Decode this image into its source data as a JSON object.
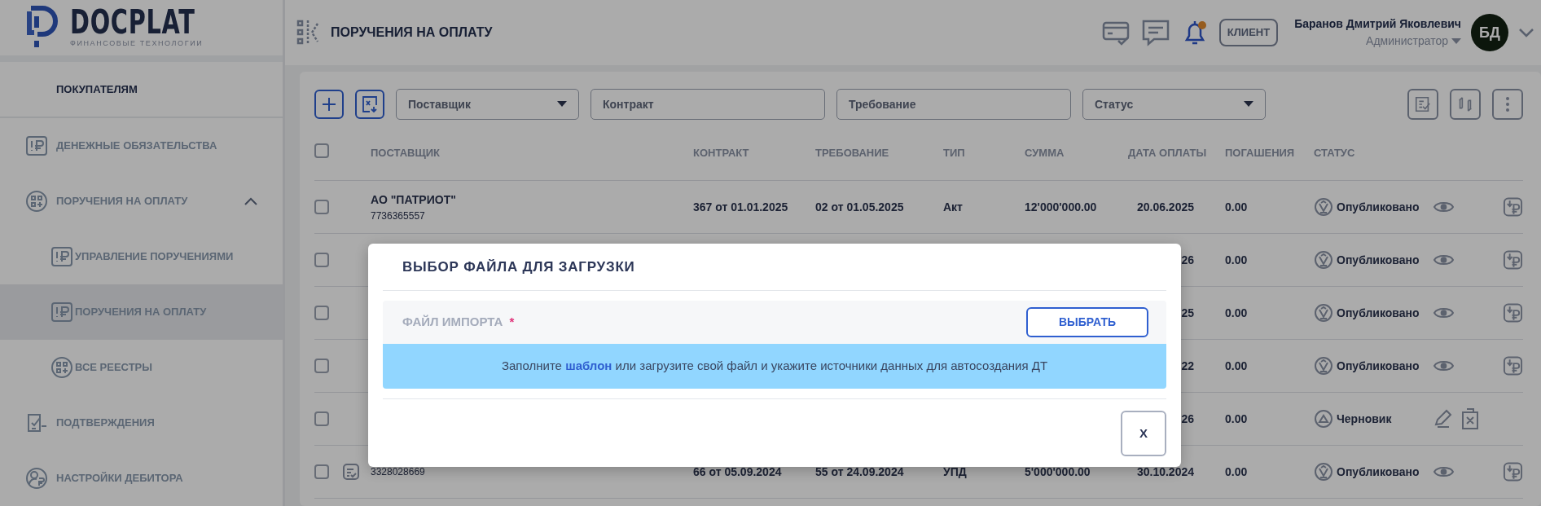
{
  "logo": {
    "name": "DOCPLAT",
    "tagline": "ФИНАНСОВЫЕ ТЕХНОЛОГИИ"
  },
  "sidebar": {
    "section": "ПОКУПАТЕЛЯМ",
    "items": [
      {
        "label": "ДЕНЕЖНЫЕ ОБЯЗАТЕЛЬСТВА",
        "selected": false
      },
      {
        "label": "ПОРУЧЕНИЯ НА ОПЛАТУ",
        "selected": false,
        "expanded": true,
        "children": [
          {
            "label": "УПРАВЛЕНИЕ ПОРУЧЕНИЯМИ",
            "selected": false
          },
          {
            "label": "ПОРУЧЕНИЯ НА ОПЛАТУ",
            "selected": true
          },
          {
            "label": "ВСЕ РЕЕСТРЫ",
            "selected": false
          }
        ]
      },
      {
        "label": "ПОДТВЕРЖДЕНИЯ",
        "selected": false
      },
      {
        "label": "НАСТРОЙКИ ДЕБИТОРА",
        "selected": false
      }
    ]
  },
  "header": {
    "title": "ПОРУЧЕНИЯ НА ОПЛАТУ",
    "notification": true,
    "role_badge": "КЛИЕНТ",
    "user_name": "Баранов Дмитрий Яковлевич",
    "user_role": "Администратор",
    "avatar_initials": "БД"
  },
  "filters": [
    {
      "kind": "select",
      "placeholder": "Поставщик"
    },
    {
      "kind": "input",
      "placeholder": "Контракт"
    },
    {
      "kind": "input",
      "placeholder": "Требование"
    },
    {
      "kind": "select",
      "placeholder": "Статус"
    }
  ],
  "table": {
    "header_checked": false,
    "columns": [
      "ПОСТАВЩИК",
      "КОНТРАКТ",
      "ТРЕБОВАНИЕ",
      "ТИП",
      "СУММА",
      "ДАТА ОПЛАТЫ",
      "ПОГАШЕНИЯ",
      "СТАТУС"
    ],
    "rows": [
      {
        "checked": false,
        "marked": false,
        "supplier": "АО \"ПАТРИОТ\"",
        "inn": "7736365557",
        "contract": "367 от 01.01.2025",
        "requirement": "02 от 01.05.2025",
        "type": "Акт",
        "sum": "12'000'000.00",
        "date": "20.06.2025",
        "repaid": "0.00",
        "status": "Опубликовано",
        "kind": "published"
      },
      {
        "checked": false,
        "marked": false,
        "date": "26",
        "repaid": "0.00",
        "status": "Опубликовано",
        "kind": "published"
      },
      {
        "checked": false,
        "marked": false,
        "date": "25",
        "repaid": "0.00",
        "status": "Опубликовано",
        "kind": "published"
      },
      {
        "checked": false,
        "marked": false,
        "date": "22",
        "repaid": "0.00",
        "status": "Опубликовано",
        "kind": "published"
      },
      {
        "checked": false,
        "marked": false,
        "date": "26",
        "repaid": "0.00",
        "status": "Черновик",
        "kind": "draft"
      },
      {
        "checked": false,
        "marked": true,
        "inn": "3328028669",
        "contract": "66 от 05.09.2024",
        "requirement": "55 от 24.09.2024",
        "type": "УПД",
        "sum": "5'000'000.00",
        "date": "30.10.2024",
        "repaid": "0.00",
        "status": "Опубликовано",
        "kind": "published"
      }
    ]
  },
  "modal": {
    "title": "ВЫБОР ФАЙЛА ДЛЯ ЗАГРУЗКИ",
    "field_label": "ФАЙЛ ИМПОРТА",
    "required_mark": "*",
    "choose_button": "ВЫБРАТЬ",
    "info": "Заполните **шаблон** или загрузите свой файл и укажите источники данных для автосоздания ДТ",
    "close_button": "X"
  }
}
